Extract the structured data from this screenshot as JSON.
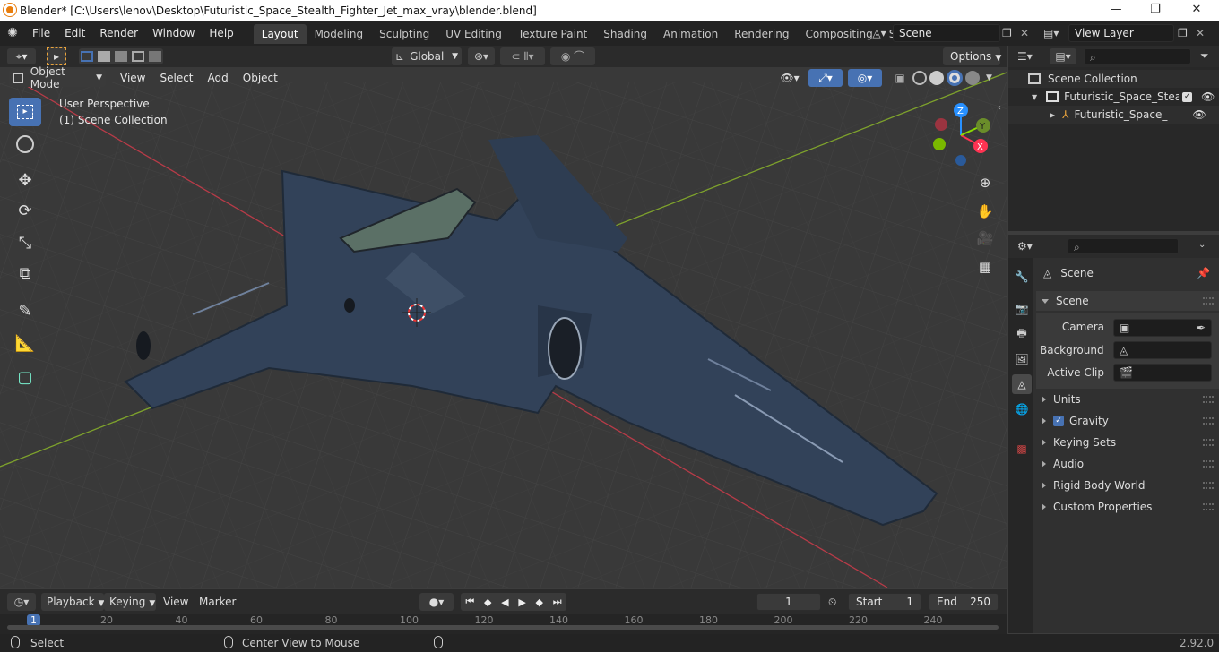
{
  "window": {
    "title": "Blender* [C:\\Users\\lenov\\Desktop\\Futuristic_Space_Stealth_Fighter_Jet_max_vray\\blender.blend]",
    "minimize": "—",
    "maximize": "❐",
    "close": "✕"
  },
  "menus": [
    "File",
    "Edit",
    "Render",
    "Window",
    "Help"
  ],
  "workspaces": [
    "Layout",
    "Modeling",
    "Sculpting",
    "UV Editing",
    "Texture Paint",
    "Shading",
    "Animation",
    "Rendering",
    "Compositing",
    "Scripting"
  ],
  "active_workspace": "Layout",
  "scene_field": "Scene",
  "view_layer_field": "View Layer",
  "viewport": {
    "transform_orientation": "Global",
    "options_label": "Options",
    "mode": "Object Mode",
    "header_menus": [
      "View",
      "Select",
      "Add",
      "Object"
    ],
    "overlay_text_line1": "User Perspective",
    "overlay_text_line2": "(1) Scene Collection",
    "gizmo_axes": {
      "z": "Z",
      "y": "Y",
      "x": "X"
    }
  },
  "outliner": {
    "root": "Scene Collection",
    "collection": "Futuristic_Space_Stealth",
    "object": "Futuristic_Space_Ste"
  },
  "properties": {
    "context": "Scene",
    "panel_title": "Scene",
    "camera_label": "Camera",
    "background_label": "Background ...",
    "active_clip_label": "Active Clip",
    "sections": [
      "Units",
      "Gravity",
      "Keying Sets",
      "Audio",
      "Rigid Body World",
      "Custom Properties"
    ],
    "gravity_checked": true
  },
  "timeline": {
    "menus": [
      "Playback",
      "Keying",
      "View",
      "Marker"
    ],
    "current_frame": "1",
    "start_label": "Start",
    "start_value": "1",
    "end_label": "End",
    "end_value": "250",
    "ruler": [
      "1",
      "20",
      "40",
      "60",
      "80",
      "100",
      "120",
      "140",
      "160",
      "180",
      "200",
      "220",
      "240"
    ]
  },
  "status": {
    "left_action": "Select",
    "middle_action": "Center View to Mouse",
    "version": "2.92.0"
  },
  "colors": {
    "accent": "#4772b3",
    "x_axis": "#ff3352",
    "y_axis": "#8bdc00",
    "z_axis": "#2890ff"
  }
}
